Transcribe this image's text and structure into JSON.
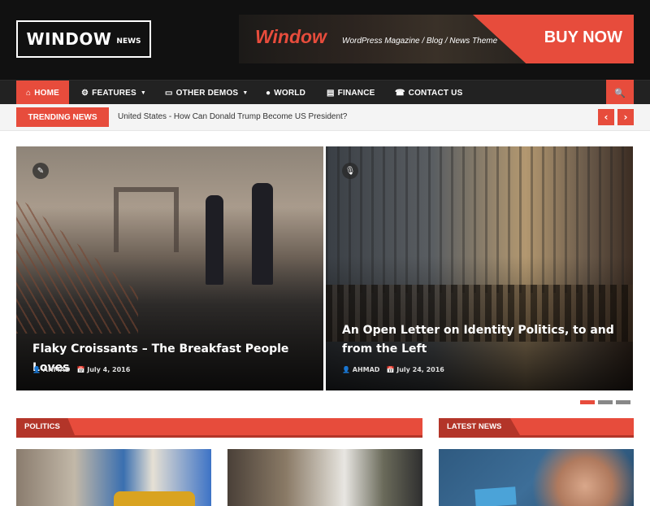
{
  "header": {
    "logo": {
      "main": "WINDOW",
      "sub": "NEWS"
    },
    "banner": {
      "brand": "Window",
      "tagline": "WordPress Magazine / Blog / News Theme",
      "cta": "BUY NOW"
    }
  },
  "nav": {
    "items": [
      {
        "label": "HOME",
        "icon": "home-icon",
        "glyph": "⌂",
        "active": true
      },
      {
        "label": "FEATURES",
        "icon": "cubes-icon",
        "glyph": "⚙",
        "dropdown": true
      },
      {
        "label": "OTHER DEMOS",
        "icon": "desktop-icon",
        "glyph": "▭",
        "dropdown": true
      },
      {
        "label": "WORLD",
        "icon": "globe-icon",
        "glyph": "●"
      },
      {
        "label": "FINANCE",
        "icon": "credit-card-icon",
        "glyph": "▤"
      },
      {
        "label": "CONTACT US",
        "icon": "phone-icon",
        "glyph": "☎"
      }
    ],
    "caret": "▼",
    "search_glyph": "🔍"
  },
  "trending": {
    "label": "TRENDING NEWS",
    "headline": "United States - How Can Donald Trump Become US President?",
    "prev": "‹",
    "next": "›"
  },
  "slider": {
    "slides": [
      {
        "format_icon": "pencil-icon",
        "format_glyph": "✎",
        "title": "Flaky Croissants – The Breakfast People Loves",
        "author": "AHMAD",
        "date": "July 4, 2016"
      },
      {
        "format_icon": "microphone-icon",
        "format_glyph": "🎙",
        "title": "An Open Letter on Identity Politics, to and from the Left",
        "author": "AHMAD",
        "date": "July 24, 2016"
      }
    ],
    "dots": {
      "count": 3,
      "active": 0
    },
    "user_glyph": "👤",
    "calendar_glyph": "📅"
  },
  "sections": {
    "politics": {
      "label": "POLITICS"
    },
    "latest": {
      "label": "LATEST NEWS"
    }
  },
  "colors": {
    "accent": "#e74c3c",
    "accent_dark": "#b33529",
    "header_bg": "#111111",
    "nav_bg": "#222222"
  }
}
